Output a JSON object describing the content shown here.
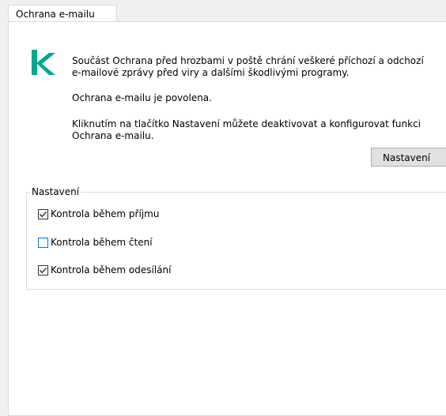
{
  "tab": {
    "label": "Ochrana e-mailu"
  },
  "description": {
    "line1": "Součást Ochrana před hrozbami v poště chrání veškeré příchozí a odchozí",
    "line2": "e-mailové zprávy před viry a dalšími škodlivými programy.",
    "status": "Ochrana e-mailu je povolena.",
    "hint_line1": "Kliknutím na tlačítko Nastavení můžete deaktivovat a konfigurovat funkci",
    "hint_line2": "Ochrana e-mailu."
  },
  "settings_button": {
    "label": "Nastavení"
  },
  "settings_group": {
    "label": "Nastavení",
    "options": [
      {
        "label": "Kontrola během příjmu",
        "checked": true
      },
      {
        "label": "Kontrola během čtení",
        "checked": false
      },
      {
        "label": "Kontrola během odesílání",
        "checked": true
      }
    ]
  },
  "colors": {
    "logo": "#00a88e",
    "checkbox_focus": "#0078d7"
  },
  "icons": {
    "logo": "kaspersky-k-logo",
    "check": "checkmark-icon"
  }
}
